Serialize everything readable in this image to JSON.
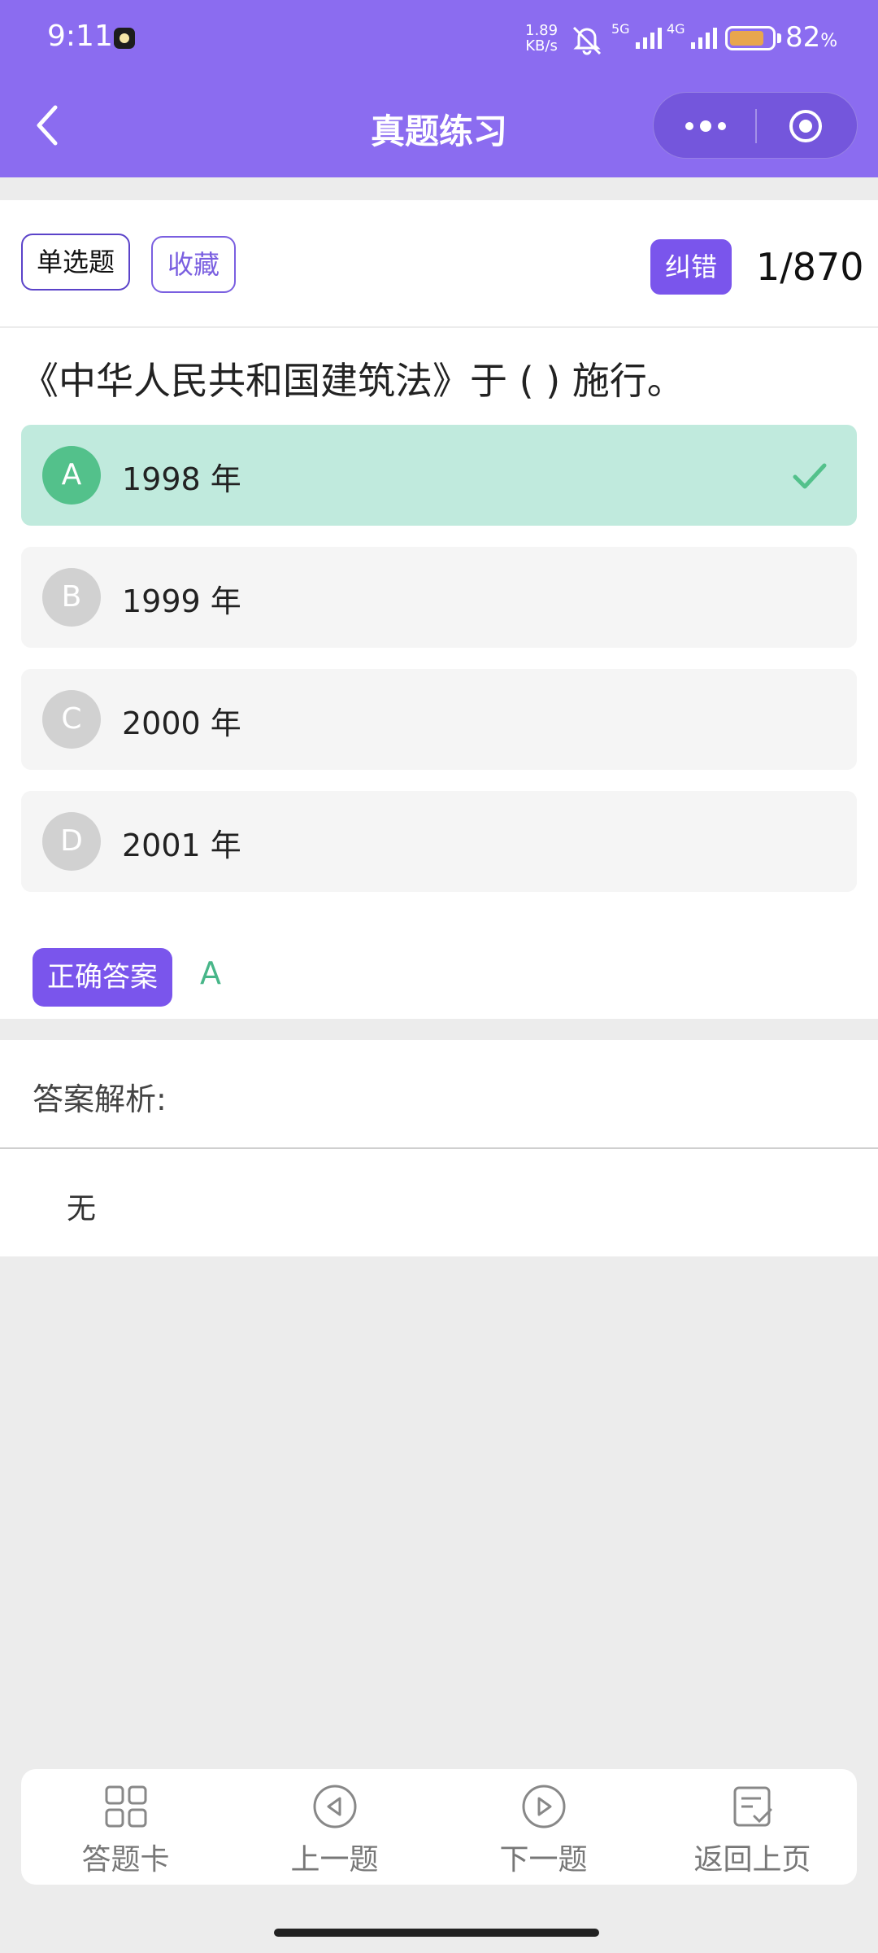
{
  "status_bar": {
    "time": "9:11",
    "net_speed_value": "1.89",
    "net_speed_unit": "KB/s",
    "sig1_label": "5G",
    "sig2_label": "4G",
    "battery_level": 0.82,
    "battery_number": "82",
    "battery_unit": "%"
  },
  "nav": {
    "back_icon": "chevron-left-icon",
    "title": "真题练习",
    "more_icon": "more-dots-icon",
    "close_icon": "target-circle-icon"
  },
  "question": {
    "type_label": "单选题",
    "favorite_label": "收藏",
    "report_error_label": "纠错",
    "progress": "1/870",
    "stem": "《中华人民共和国建筑法》于 ( ) 施行。",
    "options": [
      {
        "letter": "A",
        "text": "1998 年",
        "selected": true
      },
      {
        "letter": "B",
        "text": "1999 年",
        "selected": false
      },
      {
        "letter": "C",
        "text": "2000 年",
        "selected": false
      },
      {
        "letter": "D",
        "text": "2001 年",
        "selected": false
      }
    ],
    "correct_answer_label": "正确答案",
    "correct_answer_value": "A"
  },
  "analysis": {
    "title": "答案解析:",
    "body": "无"
  },
  "toolbar": {
    "items": [
      {
        "label": "答题卡",
        "icon": "grid-icon"
      },
      {
        "label": "上一题",
        "icon": "previous-icon"
      },
      {
        "label": "下一题",
        "icon": "next-icon"
      },
      {
        "label": "返回上页",
        "icon": "checklist-icon"
      }
    ]
  },
  "colors": {
    "header_bg": "#8b6cf0",
    "accent": "#7a55ec",
    "correct_green": "#53c18b",
    "selected_option_bg": "#c0eadd"
  }
}
